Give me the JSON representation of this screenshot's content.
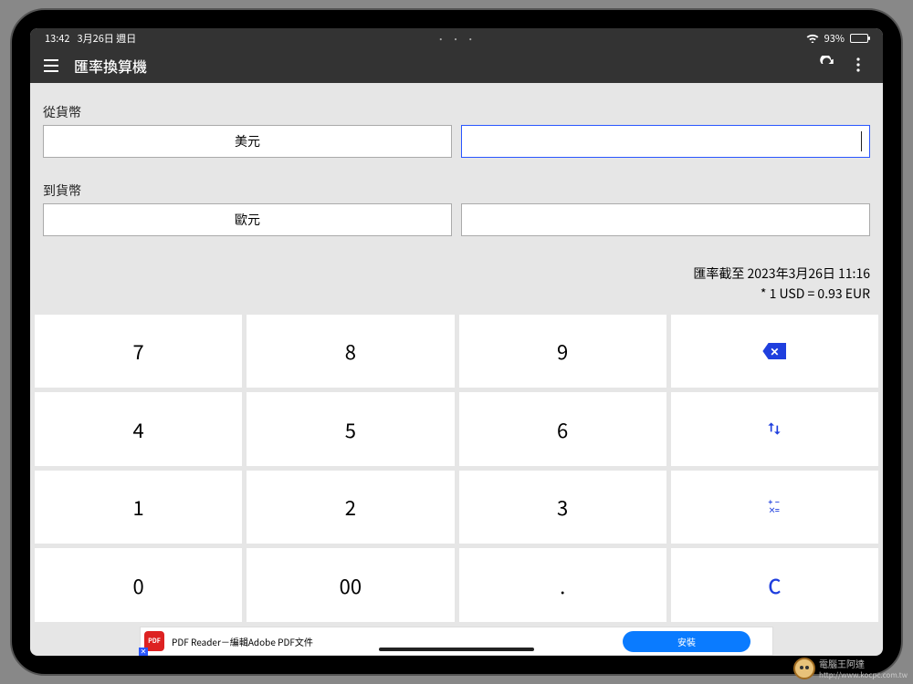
{
  "status": {
    "time": "13:42",
    "date": "3月26日 週日",
    "center_dots": "• • •",
    "battery": "93%"
  },
  "appbar": {
    "title": "匯率換算機"
  },
  "form": {
    "from_label": "從貨幣",
    "from_currency": "美元",
    "from_value": "",
    "to_label": "到貨幣",
    "to_currency": "歐元",
    "to_value": ""
  },
  "rate": {
    "asof": "匯率截至 2023年3月26日 11:16",
    "equation": "* 1 USD = 0.93 EUR"
  },
  "keypad": {
    "k7": "7",
    "k8": "8",
    "k9": "9",
    "k4": "4",
    "k5": "5",
    "k6": "6",
    "k1": "1",
    "k2": "2",
    "k3": "3",
    "k0": "0",
    "k00": "00",
    "kdot": ".",
    "kC": "C"
  },
  "ad": {
    "icon_text": "PDF",
    "text": "PDF Reader－編輯Adobe PDF文件",
    "install": "安裝"
  },
  "watermark": {
    "brand": "電腦王阿達",
    "url": "http://www.kocpc.com.tw"
  }
}
